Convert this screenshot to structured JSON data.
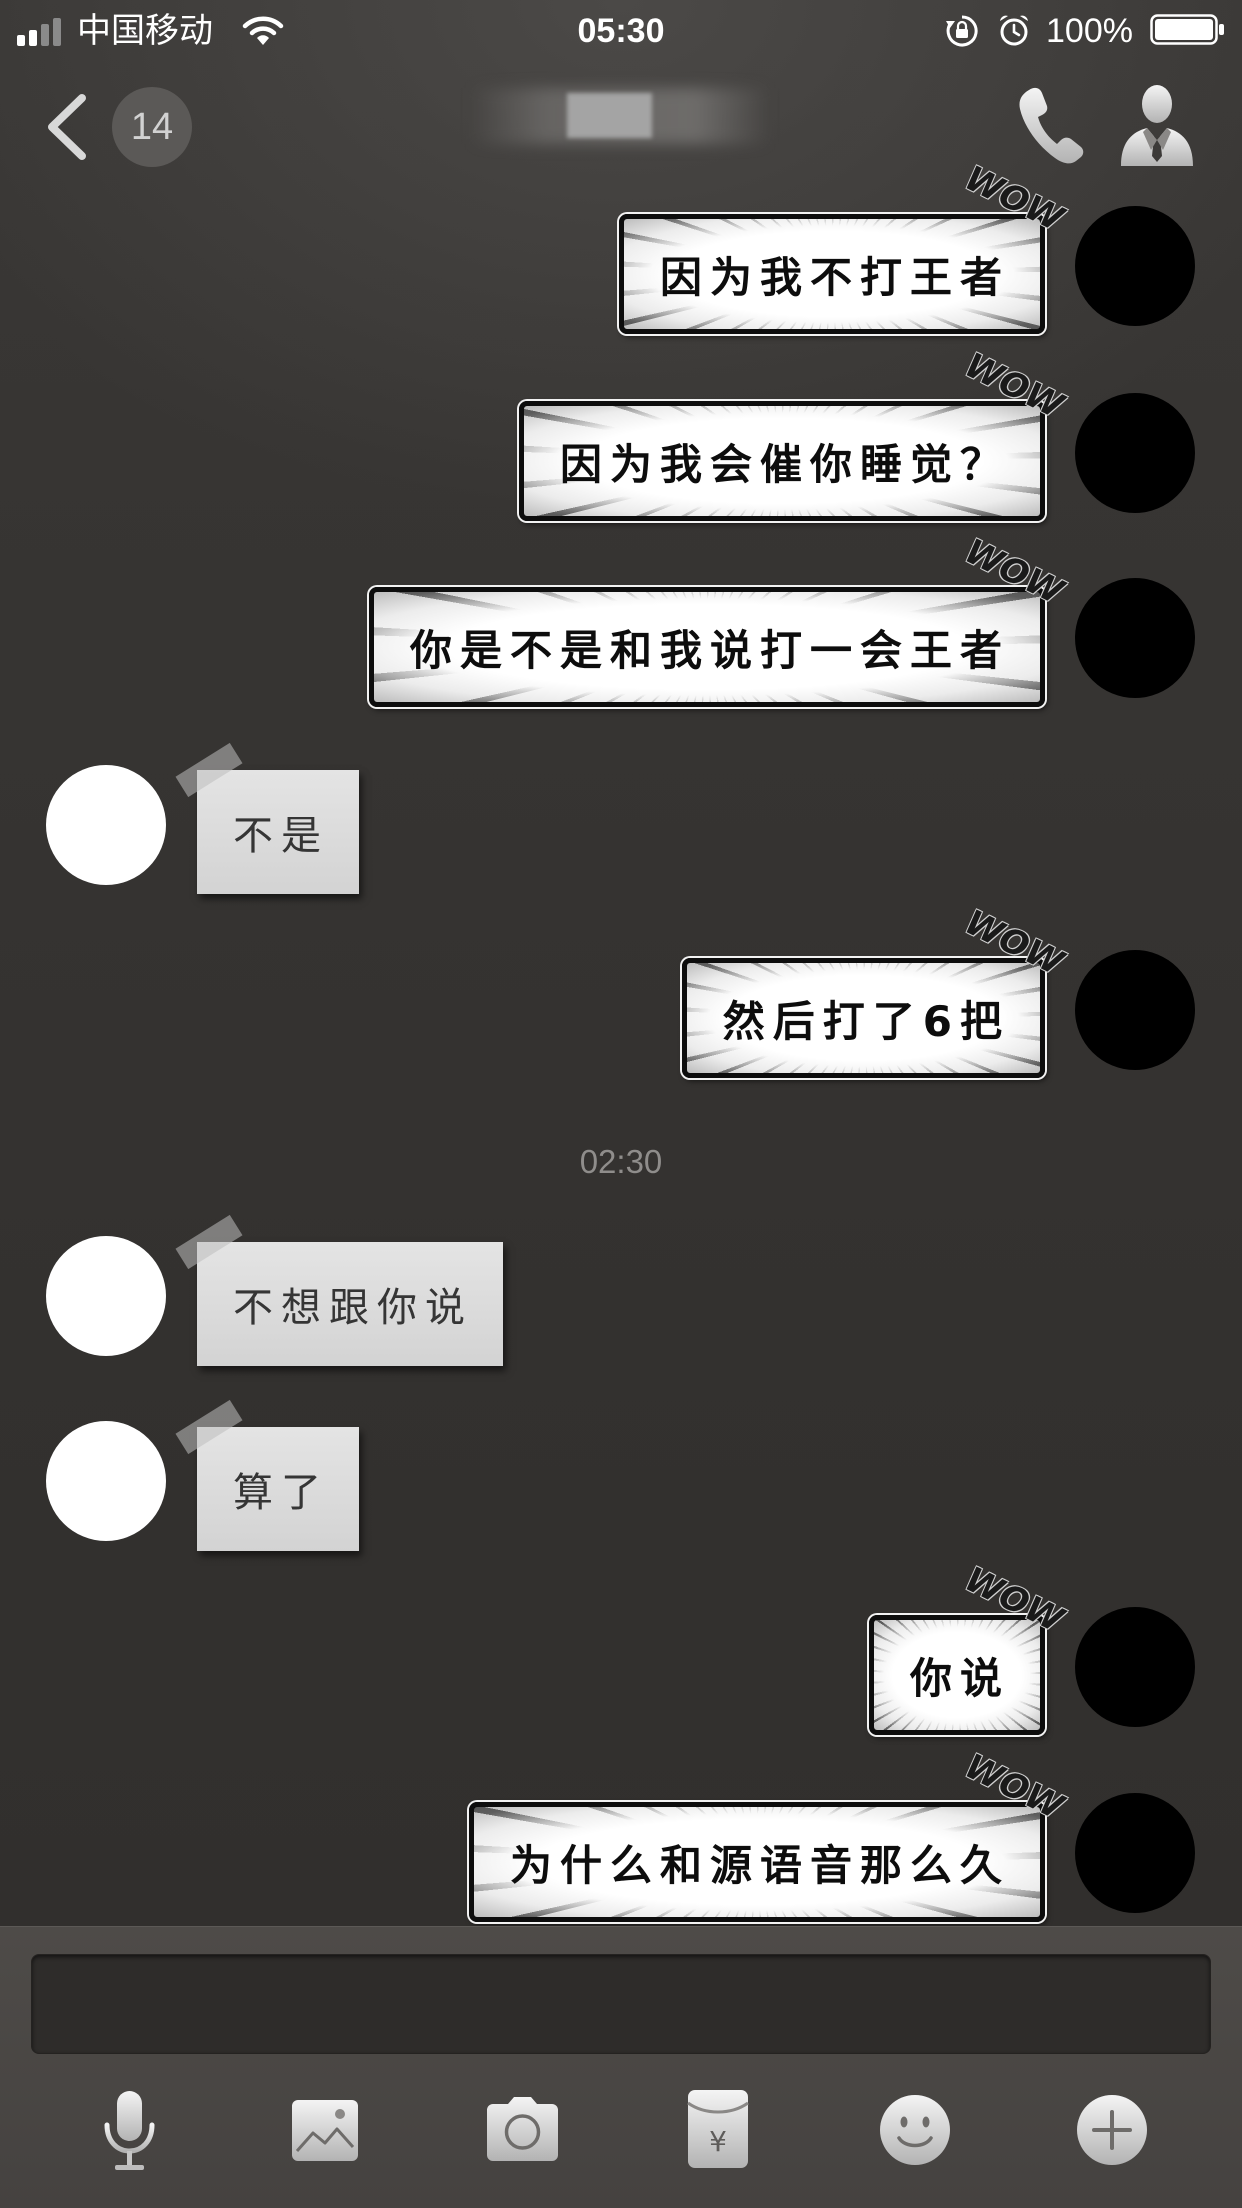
{
  "status_bar": {
    "carrier": "中国移动",
    "time": "05:30",
    "battery": "100%",
    "icons": [
      "signal-icon",
      "wifi-icon",
      "orientation-lock-icon",
      "alarm-icon",
      "battery-icon"
    ]
  },
  "nav": {
    "unread_count": "14",
    "icons": {
      "back": "chevron-left-icon",
      "call": "phone-icon",
      "profile": "person-icon"
    }
  },
  "chat": {
    "comic_badge": "WOW",
    "messages": [
      {
        "outgoing": true,
        "text": "因为我不打王者"
      },
      {
        "outgoing": true,
        "text": "因为我会催你睡觉？"
      },
      {
        "outgoing": true,
        "text": "你是不是和我说打一会王者"
      },
      {
        "outgoing": false,
        "text": "不是"
      },
      {
        "outgoing": true,
        "text": "然后打了6把"
      },
      {
        "outgoing": false,
        "text": "不想跟你说"
      },
      {
        "outgoing": false,
        "text": "算了"
      },
      {
        "outgoing": true,
        "text": "你说"
      },
      {
        "outgoing": true,
        "text": "为什么和源语音那么久"
      }
    ],
    "timestamp": "02:30"
  },
  "input": {
    "value": ""
  },
  "toolbar": {
    "icons": [
      "microphone-icon",
      "image-icon",
      "camera-icon",
      "red-packet-icon",
      "emoji-icon",
      "plus-icon"
    ],
    "red_packet_symbol": "¥"
  },
  "colors": {
    "background": "#353331",
    "panel": "#4a4744",
    "input_background": "#2e2c2a",
    "comic_bubble": "#ffffff",
    "comic_border": "#0d0d0d",
    "note_paper": "#dcdcdc",
    "outgoing_avatar": "#000000",
    "incoming_avatar": "#ffffff",
    "timestamp_text": "#8f8d8b",
    "badge": "#5b5957"
  }
}
